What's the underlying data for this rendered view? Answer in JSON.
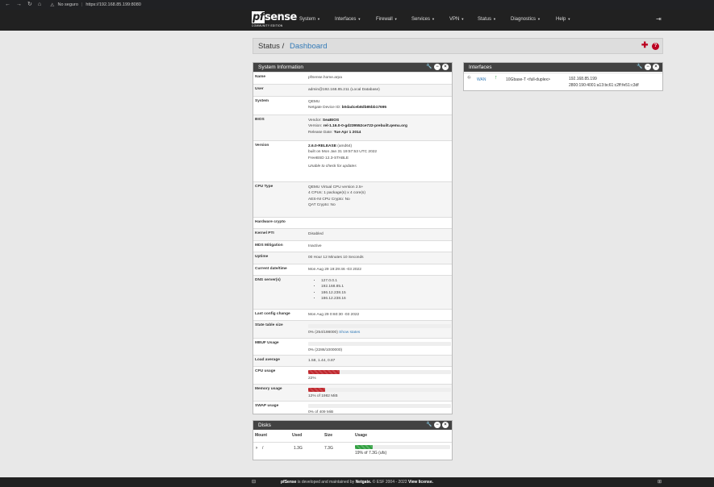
{
  "browser": {
    "warning": "No seguro",
    "url": "https://192.168.85.199:8080"
  },
  "nav": {
    "brand": "sense",
    "brand_p": "pf",
    "edition": "COMMUNITY EDITION",
    "items": [
      "System",
      "Interfaces",
      "Firewall",
      "Services",
      "VPN",
      "Status",
      "Diagnostics",
      "Help"
    ]
  },
  "breadcrumb": {
    "section": "Status /",
    "page": "Dashboard"
  },
  "system_info": {
    "title": "System Information",
    "name_label": "Name",
    "name": "pfSense.home.arpa",
    "user_label": "User",
    "user": "admin@192.168.85.211 (Local Database)",
    "system_label": "System",
    "system_l1": "QEMU",
    "system_l2_prefix": "Netgate Device ID: ",
    "system_l2_id": "b0dadceb8db85bb17695",
    "bios_label": "BIOS",
    "bios_vendor_prefix": "Vendor: ",
    "bios_vendor": "SeaBIOS",
    "bios_version_prefix": "Version: ",
    "bios_version": "rel-1.16.0-0-gd239552ce722-prebuilt.qemu.org",
    "bios_date_prefix": "Release Date: ",
    "bios_date": "Tue Apr 1 2014",
    "version_label": "Version",
    "version_main": "2.6.0-RELEASE",
    "version_arch": " (amd64)",
    "version_built": "built on Mon Jan 31 19:57:53 UTC 2022",
    "version_os": "FreeBSD 12.3-STABLE",
    "version_update": "Unable to check for updates",
    "cpu_label": "CPU Type",
    "cpu_l1": "QEMU Virtual CPU version 2.5+",
    "cpu_l2": "4 CPUs: 1 package(s) x 4 core(s)",
    "cpu_l3": "AES-NI CPU Crypto: No",
    "cpu_l4": "QAT Crypto: No",
    "hwcrypto_label": "Hardware crypto",
    "kpti_label": "Kernel PTI",
    "kpti": "Disabled",
    "mds_label": "MDS Mitigation",
    "mds": "Inactive",
    "uptime_label": "Uptime",
    "uptime": "00 Hour 12 Minutes 10 Seconds",
    "date_label": "Current date/time",
    "date": "Mon Aug 29 19:29:46 -03 2022",
    "dns_label": "DNS server(s)",
    "dns": [
      "127.0.0.1",
      "192.168.85.1",
      "186.12.238.15",
      "186.12.238.16"
    ],
    "config_label": "Last config change",
    "config": "Mon Aug 29 0:60:30 -03 2022",
    "state_label": "State table size",
    "state": "0% (254/198000)",
    "state_link": "Show states",
    "state_pct": 0,
    "mbuf_label": "MBUF Usage",
    "mbuf": "0% (2286/1000000)",
    "mbuf_pct": 0,
    "load_label": "Load average",
    "load": "1.58, 1.44, 0.87",
    "cpu_usage_label": "CPU usage",
    "cpu_usage": "22%",
    "cpu_usage_pct": 22,
    "mem_label": "Memory usage",
    "mem": "12% of 1982 MiB",
    "mem_pct": 12,
    "swap_label": "SWAP usage",
    "swap": "0% of 409 MiB",
    "swap_pct": 0
  },
  "interfaces": {
    "title": "Interfaces",
    "name": "WAN",
    "media": "10Gbase-T <full-duplex>",
    "ipv4": "192.168.85.199",
    "ipv6": "2800:190:4001:a13:bc61:c2ff:fe51:c3df"
  },
  "disks": {
    "title": "Disks",
    "headers": [
      "Mount",
      "Used",
      "Size",
      "Usage"
    ],
    "mount": "/",
    "used": "1.3G",
    "size": "7.3G",
    "usage": "19% of 7.3G (ufs)",
    "usage_pct": 19
  },
  "footer": {
    "brand": "pfSense",
    "text": " is developed and maintained by ",
    "netgate": "Netgate.",
    "copy": " © ESF 2004 - 2022 ",
    "license": "View license."
  },
  "colors": {
    "navbar": "#212121",
    "panel_head": "#424242",
    "accent": "#337ab7",
    "danger": "#c0272d",
    "ok": "#2e9e3e"
  }
}
